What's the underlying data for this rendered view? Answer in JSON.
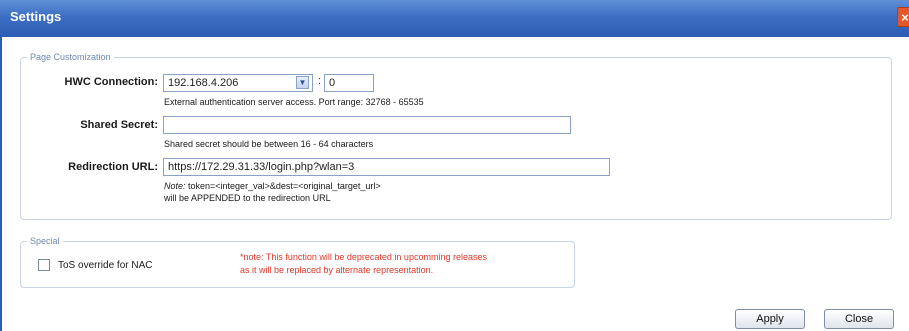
{
  "window": {
    "title": "Settings",
    "close_glyph": "×"
  },
  "page_customization": {
    "legend": "Page Customization",
    "hwc_connection": {
      "label": "HWC Connection:",
      "host_value": "192.168.4.206",
      "colon": ":",
      "port_value": "0",
      "hint": "External authentication server access. Port range: 32768 - 65535"
    },
    "shared_secret": {
      "label": "Shared Secret:",
      "value": "",
      "hint": "Shared secret should be between 16 - 64 characters"
    },
    "redirection_url": {
      "label": "Redirection URL:",
      "value": "https://172.29.31.33/login.php?wlan=3",
      "note_prefix": "Note:",
      "note_line1": " token=<integer_val>&dest=<original_target_url>",
      "note_line2": "will be APPENDED to the redirection URL"
    }
  },
  "special": {
    "legend": "Special",
    "tos_override": {
      "label": "ToS override for NAC",
      "checked": false
    },
    "deprecation_note_line1": "*note: This function will be deprecated in upcomming releases",
    "deprecation_note_line2": "as it will be replaced by alternate representation."
  },
  "footer": {
    "apply_label": "Apply",
    "close_label": "Close"
  },
  "colors": {
    "titlebar": "#3c6fc4",
    "note_red": "#e0382a",
    "legend": "#6d87b0"
  }
}
